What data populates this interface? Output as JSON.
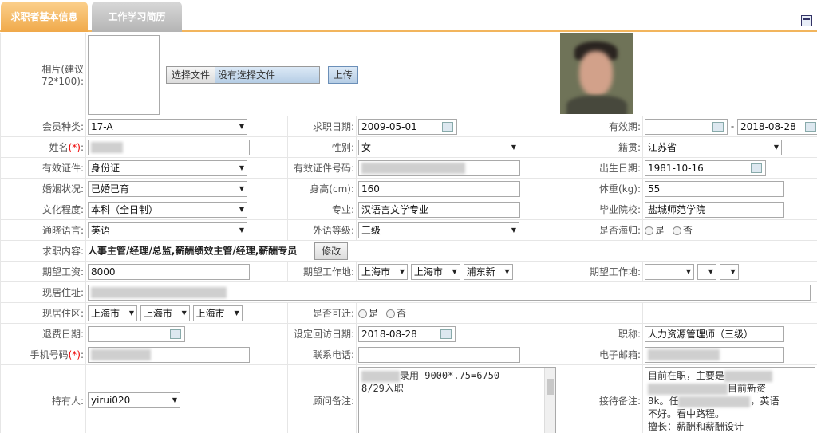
{
  "tabs": [
    {
      "label": "求职者基本信息"
    },
    {
      "label": "工作学习简历"
    }
  ],
  "photo": {
    "label": "相片(建议72*100):",
    "file_button": "选择文件",
    "file_status": "没有选择文件",
    "upload_button": "上传"
  },
  "fields": {
    "member_type": {
      "label": "会员种类:",
      "value": "17-A"
    },
    "job_date": {
      "label": "求职日期:",
      "value": "2009-05-01"
    },
    "valid_period": {
      "label": "有效期:",
      "start": "",
      "sep": "-",
      "end": "2018-08-28"
    },
    "name": {
      "label": "姓名",
      "req": "(*)",
      "colon": ":"
    },
    "gender": {
      "label": "性别:",
      "value": "女"
    },
    "native": {
      "label": "籍贯:",
      "value": "江苏省"
    },
    "id_type": {
      "label": "有效证件:",
      "value": "身份证"
    },
    "id_number": {
      "label": "有效证件号码:"
    },
    "birth": {
      "label": "出生日期:",
      "value": "1981-10-16"
    },
    "marital": {
      "label": "婚姻状况:",
      "value": "已婚已育"
    },
    "height": {
      "label": "身高(cm):",
      "value": "160"
    },
    "weight": {
      "label": "体重(kg):",
      "value": "55"
    },
    "education": {
      "label": "文化程度:",
      "value": "本科（全日制）"
    },
    "major": {
      "label": "专业:",
      "value": "汉语言文学专业"
    },
    "school": {
      "label": "毕业院校:",
      "value": "盐城师范学院"
    },
    "language": {
      "label": "通晓语言:",
      "value": "英语"
    },
    "lang_level": {
      "label": "外语等级:",
      "value": "三级"
    },
    "returnee": {
      "label": "是否海归:",
      "opt_yes": "是",
      "opt_no": "否"
    },
    "job_content": {
      "label": "求职内容:",
      "value": "人事主管/经理/总监,薪酬绩效主管/经理,薪酬专员",
      "button": "修改"
    },
    "expected_salary": {
      "label": "期望工资:",
      "value": "8000"
    },
    "expected_location": {
      "label": "期望工作地:",
      "province": "上海市",
      "city": "上海市",
      "district": "浦东新"
    },
    "expected_location2": {
      "label": "期望工作地:"
    },
    "address": {
      "label": "现居住址:"
    },
    "current_area": {
      "label": "现居住区:",
      "province": "上海市",
      "city": "上海市",
      "district": "上海市"
    },
    "relocate": {
      "label": "是否可迁:",
      "opt_yes": "是",
      "opt_no": "否"
    },
    "refund_date": {
      "label": "退费日期:",
      "value": ""
    },
    "callback_date": {
      "label": "设定回访日期:",
      "value": "2018-08-28"
    },
    "title": {
      "label": "职称:",
      "value": "人力资源管理师（三级）"
    },
    "mobile": {
      "label": "手机号码",
      "req": "(*)",
      "colon": ":"
    },
    "phone": {
      "label": "联系电话:",
      "value": ""
    },
    "email": {
      "label": "电子邮箱:"
    },
    "holder": {
      "label": "持有人:",
      "value": "yirui020"
    },
    "consultant_note": {
      "label": "顾问备注:",
      "line1": "录用   9000*.75=6750",
      "line2": "8/29入职"
    },
    "reception_note": {
      "label": "接待备注:",
      "line1a": "目前在职，主要是",
      "line2b": "目前新资",
      "line3a": "8k。任",
      "line3b": "，英语",
      "line4": "不好。看中路程。",
      "line5": "擅长：薪酬和薪酬设计"
    }
  }
}
